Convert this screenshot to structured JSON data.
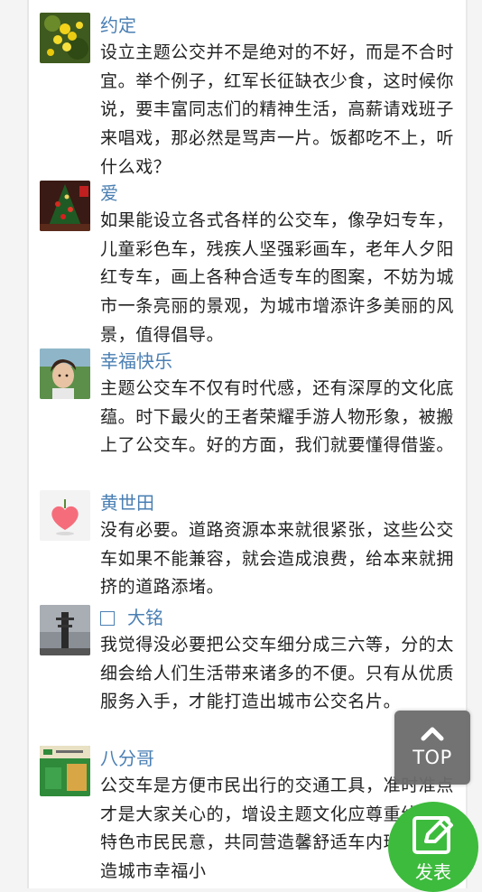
{
  "comments": [
    {
      "name": "约定",
      "text": "设立主题公交并不是绝对的不好，而是不合时宜。举个例子，红军长征缺衣少食，这时候你说，要丰富同志们的精神生活，高薪请戏班子来唱戏，那必然是骂声一片。饭都吃不上，听什么戏？"
    },
    {
      "name": "爱",
      "text": "如果能设立各式各样的公交车，像孕妇专车，儿童彩色车，残疾人坚强彩画车，老年人夕阳红专车，画上各种合适专车的图案，不妨为城市一条亮丽的景观，为城市增添许多美丽的风景，值得倡导。"
    },
    {
      "name": "幸福快乐",
      "text": "主题公交车不仅有时代感，还有深厚的文化底蕴。时下最火的王者荣耀手游人物形象，被搬上了公交车。好的方面，我们就要懂得借鉴。"
    },
    {
      "name": "黄世田",
      "text": "没有必要。道路资源本来就很紧张，这些公交车如果不能兼容，就会造成浪费，给本来就拥挤的道路添堵。"
    },
    {
      "name": "大铭",
      "text": "我觉得没必要把公交车细分成三六等，分的太细会给人们生活带来诸多的不便。只有从优质服务入手，才能打造出城市公交名片。"
    },
    {
      "name": "八分哥",
      "text": "公交车是方便市民出行的交通工具，准时准点才是大家关心的，增设主题文化应尊重线路的特色市民民意，共同营造馨舒适车内环境，营造城市幸福小"
    }
  ],
  "top_button": {
    "label": "TOP",
    "icon": "chevron-up-icon"
  },
  "post_button": {
    "label": "发表",
    "icon": "edit-icon",
    "color": "#3dbb3d"
  },
  "colors": {
    "name": "#4a7fb3",
    "text": "#222222",
    "background": "#f4f4f4"
  }
}
